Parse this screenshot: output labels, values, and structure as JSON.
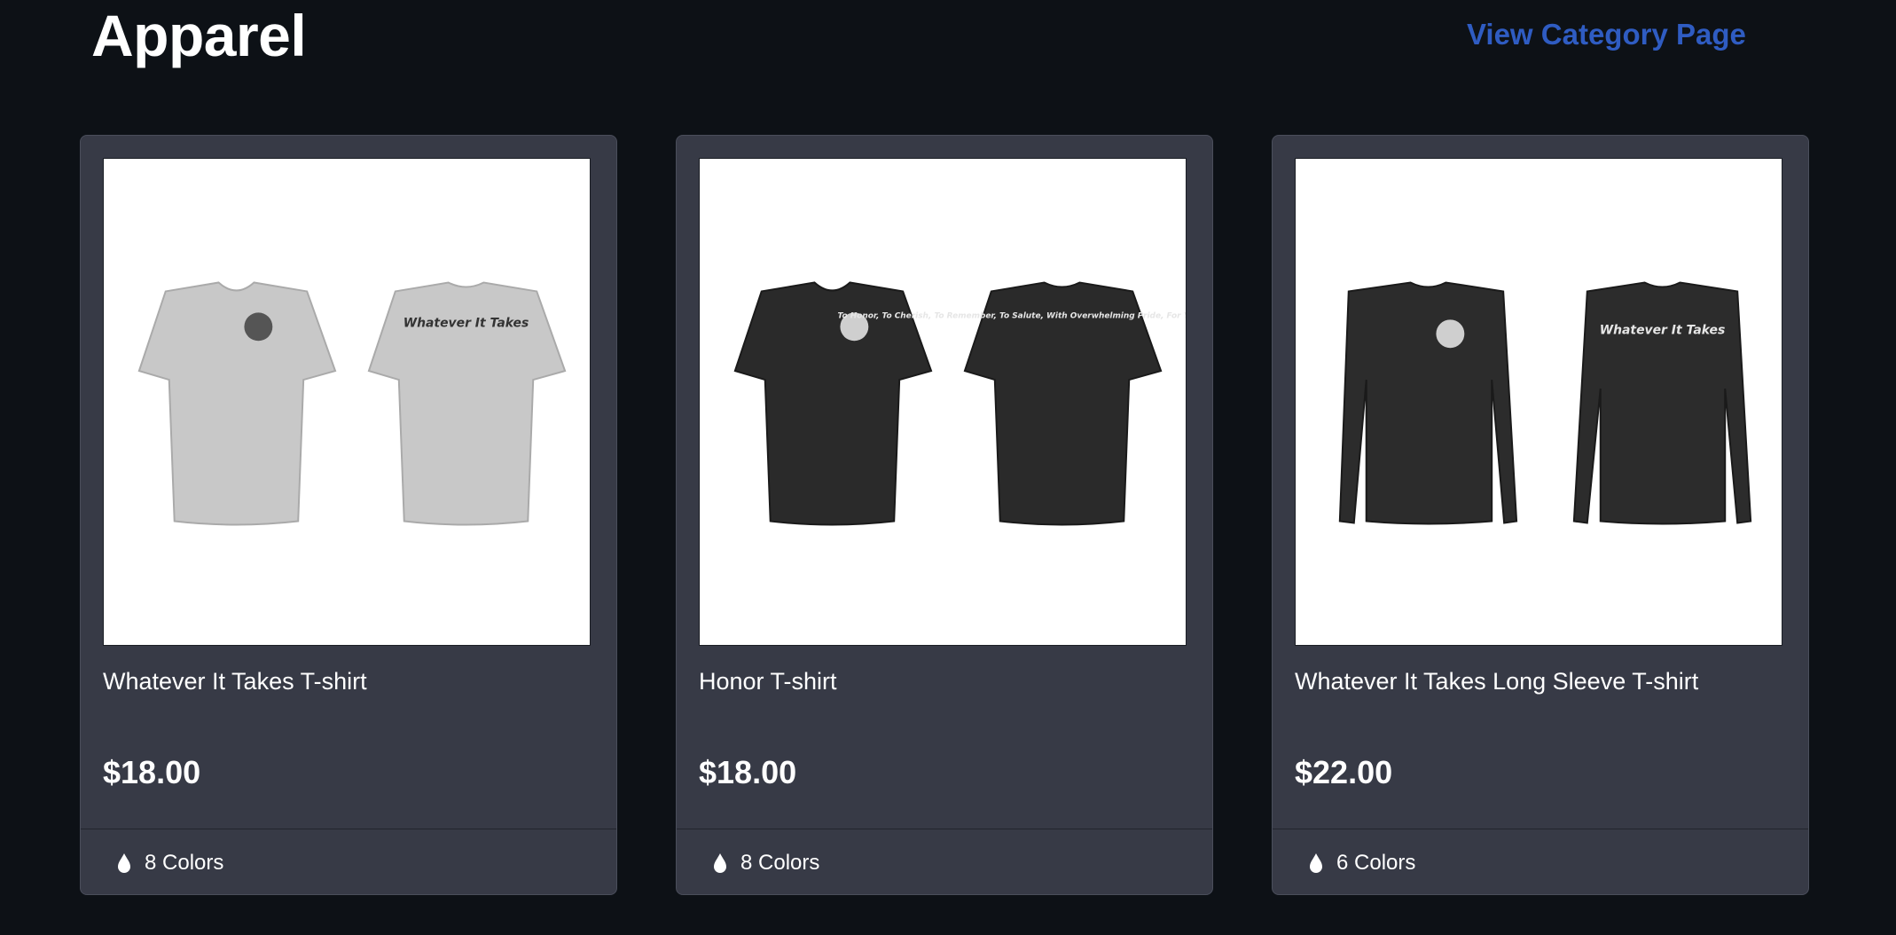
{
  "section": {
    "title": "Apparel",
    "link_label": "View Category Page"
  },
  "products": [
    {
      "title": "Whatever It Takes T-shirt",
      "price": "$18.00",
      "colors_label": "8 Colors",
      "shirt_color": "#c8c8c8",
      "back_print": "Whatever It Takes"
    },
    {
      "title": "Honor T-shirt",
      "price": "$18.00",
      "colors_label": "8 Colors",
      "shirt_color": "#2a2a2a",
      "back_print": "To Honor, To Cherish, To Remember, To Salute, With Overwhelming Pride, For You My Comrade, I Will"
    },
    {
      "title": "Whatever It Takes Long Sleeve T-shirt",
      "price": "$22.00",
      "colors_label": "6 Colors",
      "shirt_color": "#2c2c2c",
      "back_print": "Whatever It Takes"
    }
  ],
  "colors": {
    "background": "#0d1116",
    "card": "#373a46",
    "link": "#2f5cc2"
  },
  "icons": {
    "colors": "drop-icon"
  }
}
